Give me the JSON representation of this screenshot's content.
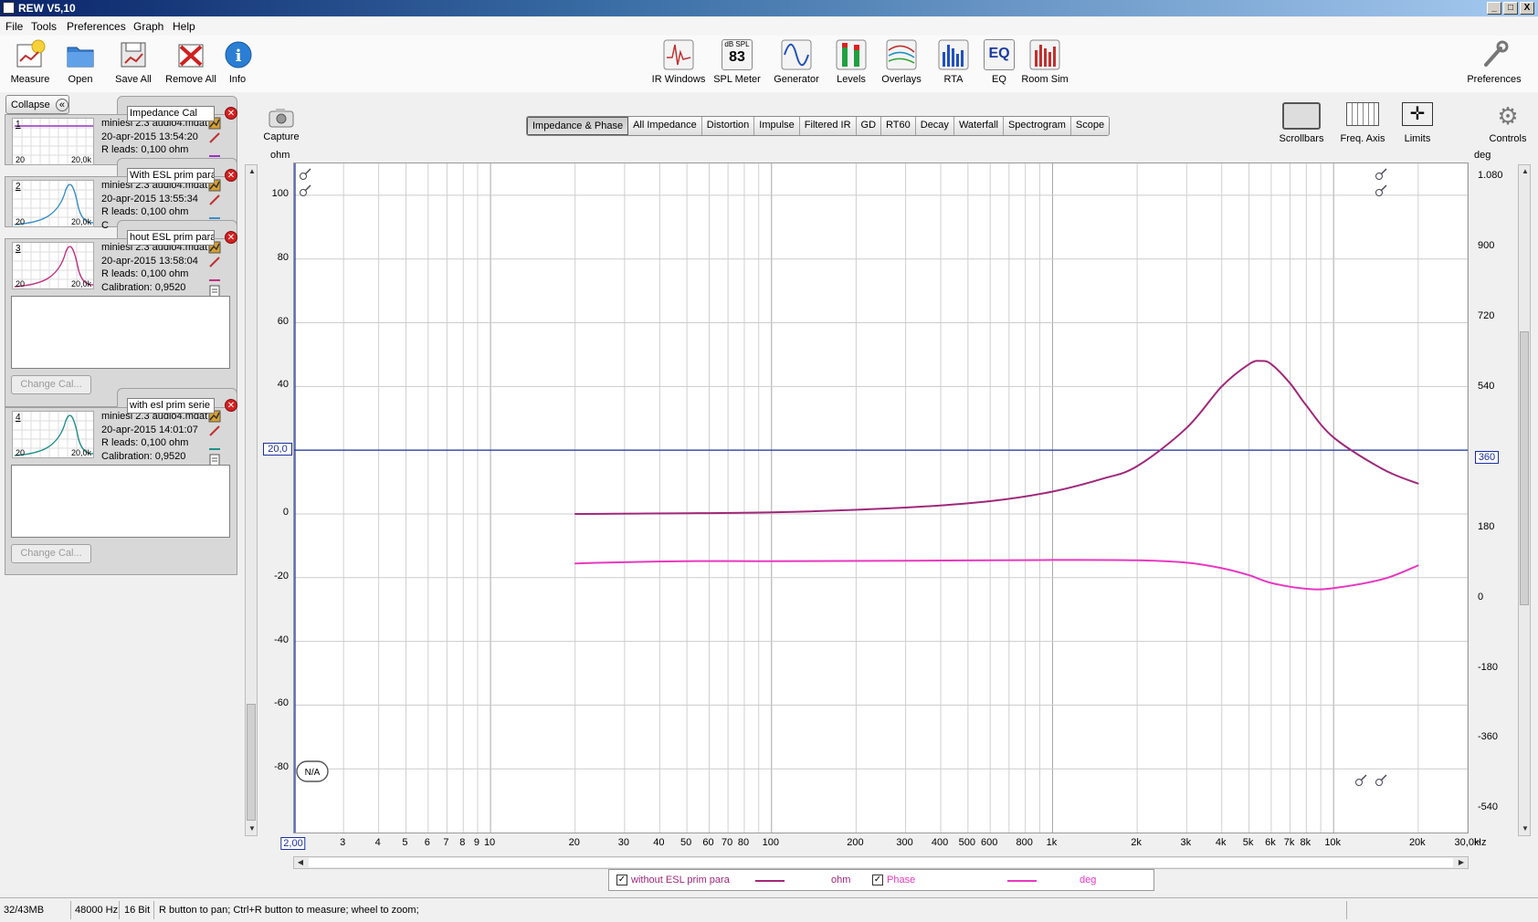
{
  "window": {
    "title": "REW V5,10",
    "min": "_",
    "max": "□",
    "close": "X"
  },
  "menu": [
    "File",
    "Tools",
    "Preferences",
    "Graph",
    "Help"
  ],
  "toolbar_left": [
    "Measure",
    "Open",
    "Save All",
    "Remove All",
    "Info"
  ],
  "toolbar_center": {
    "ir_windows": "IR Windows",
    "spl_meter": "SPL Meter",
    "spl_badge": "dB SPL",
    "spl_value": "83",
    "generator": "Generator",
    "levels": "Levels",
    "overlays": "Overlays",
    "rta": "RTA",
    "eq": "EQ",
    "eq_badge": "EQ",
    "room_sim": "Room Sim"
  },
  "toolbar_right": {
    "preferences": "Preferences"
  },
  "panel": {
    "collapse": "Collapse",
    "collapse_icon": "«",
    "measurements": [
      {
        "num": "1",
        "name": "Impedance Cal",
        "file": "miniesl 2.3 audio4.mdat",
        "date": "20-apr-2015 13:54:20",
        "rleads": "R leads: 0,100 ohm",
        "xmin": "20",
        "xmax": "20,0k",
        "color": "#9a30c8"
      },
      {
        "num": "2",
        "name": "With ESL prim para",
        "file": "miniesl 2.3 audio4.mdat",
        "date": "20-apr-2015 13:55:34",
        "rleads": "R leads: 0,100 ohm",
        "cut": "C",
        "xmin": "20",
        "xmax": "20,0k",
        "color": "#3a8fc8"
      },
      {
        "num": "3",
        "name": "hout ESL prim para",
        "file": "miniesl 2.3 audio4.mdat",
        "date": "20-apr-2015 13:58:04",
        "rleads": "R leads: 0,100 ohm",
        "cal": "Calibration: 0,9520",
        "xmin": "20",
        "xmax": "20,0k",
        "color": "#c03080",
        "change_cal": "Change Cal..."
      },
      {
        "num": "4",
        "name": "with esl prim serie",
        "file": "miniesl 2.3 audio4.mdat",
        "date": "20-apr-2015 14:01:07",
        "rleads": "R leads: 0,100 ohm",
        "cal": "Calibration: 0,9520",
        "xmin": "20",
        "xmax": "20,0k",
        "color": "#20908a",
        "change_cal": "Change Cal..."
      }
    ]
  },
  "capture": "Capture",
  "graph_tabs": [
    "Impedance & Phase",
    "All Impedance",
    "Distortion",
    "Impulse",
    "Filtered IR",
    "GD",
    "RT60",
    "Decay",
    "Waterfall",
    "Spectrogram",
    "Scope"
  ],
  "right_tools": [
    "Scrollbars",
    "Freq. Axis",
    "Limits",
    "Controls"
  ],
  "chart_data": {
    "type": "line",
    "y_unit": "ohm",
    "y2_unit": "deg",
    "x_unit": "Hz",
    "x_scale": "log",
    "xlim": [
      2,
      30000
    ],
    "ylim": [
      -100,
      110
    ],
    "y2lim": [
      -600,
      1116
    ],
    "y_ticks": [
      "100",
      "80",
      "60",
      "40",
      "20,0",
      "0",
      "-20",
      "-40",
      "-60",
      "-80"
    ],
    "y2_ticks": [
      "1.080",
      "900",
      "720",
      "540",
      "360",
      "180",
      "0",
      "-180",
      "-360",
      "-540"
    ],
    "x_ticks": [
      "2,00",
      "3",
      "4",
      "5",
      "6",
      "7",
      "8",
      "9",
      "10",
      "20",
      "30",
      "40",
      "50",
      "60",
      "70",
      "80",
      "100",
      "200",
      "300",
      "400",
      "500",
      "600",
      "800",
      "1k",
      "2k",
      "3k",
      "4k",
      "5k",
      "6k",
      "7k",
      "8k",
      "10k",
      "20k",
      "30,0k"
    ],
    "cursor": {
      "y_left": "20,0",
      "y_right": "360"
    },
    "na_label": "N/A",
    "series": [
      {
        "name": "without ESL prim para",
        "unit": "ohm",
        "color": "#a0287a",
        "x": [
          20,
          100,
          300,
          600,
          1000,
          1500,
          2000,
          3000,
          4000,
          5000,
          5500,
          6000,
          7000,
          8000,
          10000,
          15000,
          20000
        ],
        "y": [
          0,
          0.5,
          2,
          4,
          7,
          11,
          15,
          27,
          40,
          47,
          48,
          47,
          41,
          34,
          24,
          14,
          9.5
        ]
      },
      {
        "name": "Phase",
        "unit": "deg",
        "color": "#e838c0",
        "x": [
          20,
          25,
          50,
          100,
          300,
          1000,
          2000,
          3000,
          4000,
          5000,
          6000,
          8000,
          10000,
          15000,
          20000
        ],
        "y": [
          90,
          92,
          96,
          96,
          97,
          99,
          98,
          92,
          78,
          60,
          40,
          25,
          27,
          50,
          85
        ]
      }
    ]
  },
  "legend": [
    {
      "label": "without ESL prim para",
      "unit": "ohm",
      "color": "#a0287a",
      "check": "✓"
    },
    {
      "label": "Phase",
      "unit": "deg",
      "color": "#e838c0",
      "check": "✓"
    }
  ],
  "status": {
    "memory": "32/43MB",
    "rate": "48000 Hz",
    "bits": "16 Bit",
    "hint": "R button to pan; Ctrl+R button to measure; wheel to zoom;"
  }
}
